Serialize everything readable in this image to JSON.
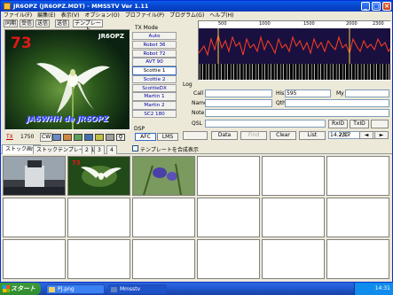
{
  "window": {
    "title": "JR6OPZ (JR6OPZ.MDT) - MMSSTV Ver 1.11"
  },
  "menu": [
    "ファイル(F)",
    "編集(E)",
    "表示(V)",
    "オプション(O)",
    "プロファイル(P)",
    "プログラム(G)",
    "ヘルプ(H)"
  ],
  "toolbar": {
    "buttons": [
      "同期",
      "受信",
      "送信",
      "送信",
      "テンプレート"
    ]
  },
  "picture": {
    "number": "73",
    "callsign": "JR6OPZ",
    "footer": "JA6WHH de JR6OPZ"
  },
  "tx_mode": {
    "header": "TX Mode",
    "modes": [
      "Auto",
      "Robot 36",
      "Robot 72",
      "AVT 90",
      "Scottie 1",
      "Scottie 2",
      "ScottieDX",
      "Martin 1",
      "Martin 2",
      "SC2 180"
    ],
    "selected": "Scottie 1"
  },
  "dsp": {
    "label": "DSP",
    "buttons": [
      "AFC",
      "LMS"
    ]
  },
  "spectrum": {
    "scale": [
      "500",
      "1000",
      "1500",
      "2000",
      "2300"
    ]
  },
  "controls": {
    "tx_label": "TX",
    "tx_value": "1750",
    "cw_label": "CW"
  },
  "log": {
    "title": "Log",
    "call_label": "Call",
    "his_label": "His",
    "his_value": "595",
    "my_label": "My",
    "name_label": "Name",
    "qth_label": "Qth",
    "note_label": "Note",
    "qsl_label": "QSL",
    "rxid": "RxID",
    "txid": "TxID",
    "buttons": [
      "Data",
      "Find",
      "Clear",
      "List"
    ],
    "frequency": "14.230",
    "page": "2/17"
  },
  "tabs": {
    "items": [
      "ストック画像",
      "ストックテンプレート 1",
      "2",
      "3",
      "4"
    ],
    "template_check": "テンプレートを合成表示"
  },
  "taskbar": {
    "start": "スタート",
    "tasks": [
      "PJ.png",
      "Mmsstv"
    ],
    "clock": "14:31"
  }
}
